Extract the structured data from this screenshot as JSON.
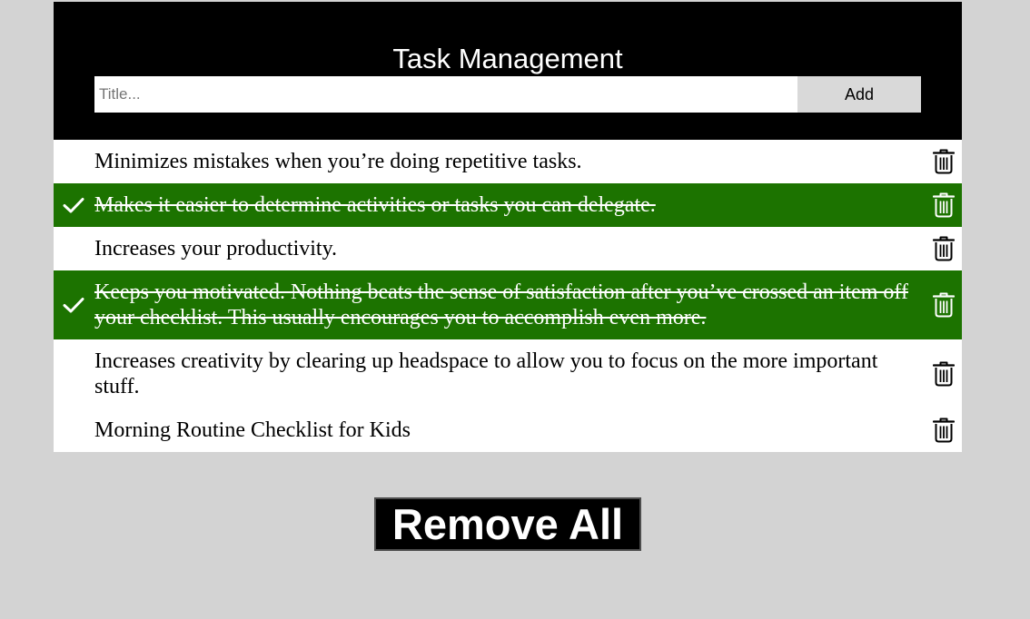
{
  "header": {
    "title": "Task Management",
    "input_placeholder": "Title...",
    "input_value": "",
    "add_label": "Add"
  },
  "tasks": [
    {
      "text": "Minimizes mistakes when you’re doing repetitive tasks.",
      "checked": false
    },
    {
      "text": "Makes it easier to determine activities or tasks you can delegate.",
      "checked": true
    },
    {
      "text": "Increases your productivity.",
      "checked": false
    },
    {
      "text": "Keeps you motivated. Nothing beats the sense of satisfaction after you’ve crossed an item off your checklist. This usually encourages you to accomplish even more.",
      "checked": true
    },
    {
      "text": "Increases creativity by clearing up headspace to allow you to focus on the more important stuff.",
      "checked": false
    },
    {
      "text": "Morning Routine Checklist for Kids",
      "checked": false
    }
  ],
  "remove_all_label": "Remove All",
  "icons": {
    "check": "check-icon",
    "delete": "trash-icon"
  },
  "colors": {
    "background": "#d3d3d3",
    "header_background": "#000000",
    "checked_background": "#1c7300",
    "add_button_background": "#d9d9d9"
  }
}
